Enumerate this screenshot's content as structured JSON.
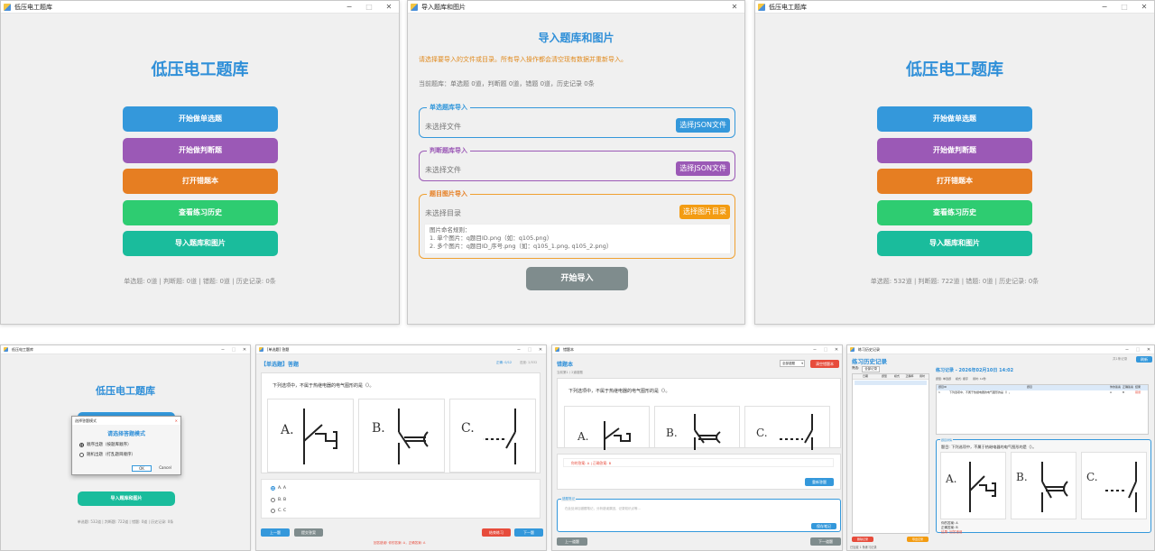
{
  "main_left": {
    "title": "低压电工题库",
    "heading": "低压电工题库",
    "buttons": [
      "开始做单选题",
      "开始做判断题",
      "打开错题本",
      "查看练习历史",
      "导入题库和图片"
    ],
    "stats": "单选题: 0道 | 判断题: 0道 | 错题: 0道 | 历史记录: 0条"
  },
  "import": {
    "title": "导入题库和图片",
    "heading": "导入题库和图片",
    "warning": "请选择要导入的文件或目录。所有导入操作都会清空现有数据并重新导入。",
    "current": "当前题库：单选题 0道，判断题 0道，错题 0道，历史记录 0条",
    "single_label": "单选题库导入",
    "single_file": "未选择文件",
    "single_btn": "选择JSON文件",
    "judge_label": "判断题库导入",
    "judge_file": "未选择文件",
    "judge_btn": "选择JSON文件",
    "image_label": "题目图片导入",
    "image_dir": "未选择目录",
    "image_btn": "选择图片目录",
    "rules_title": "图片命名规则：",
    "rule1": "1. 单个图片：q题目ID.png（如：q105.png）",
    "rule2": "2. 多个图片：q题目ID_序号.png（如：q105_1.png, q105_2.png）",
    "start_btn": "开始导入"
  },
  "main_right": {
    "title": "低压电工题库",
    "heading": "低压电工题库",
    "buttons": [
      "开始做单选题",
      "开始做判断题",
      "打开错题本",
      "查看练习历史",
      "导入题库和图片"
    ],
    "stats": "单选题: 532道 | 判断题: 722道 | 错题: 0道 | 历史记录: 0条"
  },
  "mode_dialog_win": {
    "title": "低压电工题库",
    "heading": "低压电工题库",
    "bottom_btn": "导入题库和图片",
    "stats": "单选题: 532道 | 判断题: 722道 | 错题: 0道 | 历史记录: 0条",
    "dialog_title": "选择答题模式",
    "dialog_heading": "请选择答题模式",
    "option1": "顺序出题（按题库顺序）",
    "option2": "随机出题（打乱题目顺序）",
    "ok": "OK",
    "cancel": "Cancel"
  },
  "quiz": {
    "title": "[单选题] 答题",
    "header": "【单选题】答题",
    "progress": "正确: 0/12",
    "progress2": "进度: 2/532",
    "question": "下列选项中，不属于热继电器的电气图形的是（）。",
    "labels": [
      "A.",
      "B.",
      "C."
    ],
    "options": [
      "A. A",
      "B. B",
      "C. C"
    ],
    "prev": "上一题",
    "submit": "提交答案",
    "end": "结束练习",
    "next": "下一题",
    "result": "回答错误! 你的答案: A，正确答案: A"
  },
  "wrongbook": {
    "title": "错题本",
    "header": "错题本",
    "filter": "全部错题",
    "clear_btn": "清空错题本",
    "count": "当前第1 / 2道错题",
    "question": "下列选项中，不属于热继电器的电气图形的是（）。",
    "labels": [
      "A.",
      "B.",
      "C."
    ],
    "answer": "你的答案: A | 正确答案: B",
    "redo": "重新答题",
    "note_label": "错题笔记",
    "note_placeholder": "在此处添加错题笔记，分析错误原因、记录知识点等...",
    "save_note": "保存笔记",
    "prev": "上一道题",
    "next": "下一道题"
  },
  "history": {
    "title": "练习历史记录",
    "heading": "练习历史记录",
    "top_right": "共1条记录",
    "top_btn": "刷新",
    "filter_label": "筛选:",
    "filter_value": "全部记录",
    "list_headers": [
      "日期",
      "题型",
      "模式",
      "正确率",
      "用时"
    ],
    "detail_title": "练习记录 - 2026年02月10日 14:02",
    "detail_tabs": [
      "题型: 单选题",
      "模式: 顺序",
      "用时: 12秒"
    ],
    "table_headers": [
      "题目ID",
      "题目",
      "你的答案",
      "正确答案",
      "结果"
    ],
    "table_row": [
      "1",
      "下列选项中，不属于热继电器的电气图形的是（）。",
      "A",
      "B",
      "错误"
    ],
    "detail_q_label": "题目详情",
    "detail_q": "题目: 下列选项中，不属于热继电器的电气图形的是（）。",
    "labels": [
      "A.",
      "B.",
      "C."
    ],
    "your_answer": "你的答案: A",
    "correct_answer": "正确答案: B",
    "result": "结果: 回答错误",
    "delete_btn": "删除记录",
    "export_btn": "导出记录",
    "footer": "已加载 1 条练习记录"
  },
  "colors": {
    "accent_blue": "#3498db",
    "purple": "#9b59b6",
    "orange": "#e67e22",
    "green": "#2ecc71",
    "teal": "#1abc9c",
    "gray": "#7f8c8d",
    "red": "#e74c3c"
  }
}
